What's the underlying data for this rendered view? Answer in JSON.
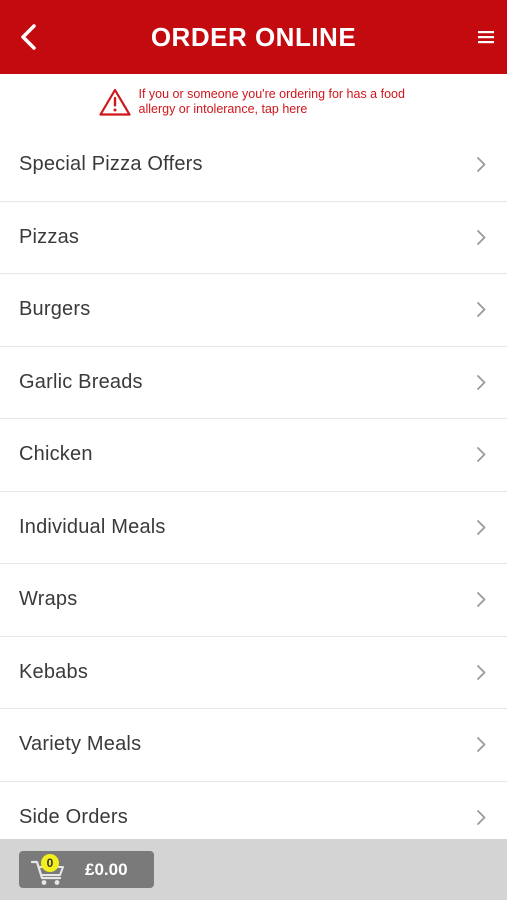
{
  "header": {
    "title": "ORDER ONLINE",
    "back_icon": "chevron-left-icon",
    "menu_icon": "hamburger-menu-icon",
    "background_color": "#c30a0f"
  },
  "allergy_notice": {
    "icon": "warning-triangle-icon",
    "text": "If you or someone you're ordering for has a food allergy or intolerance, tap here",
    "color": "#d0161b"
  },
  "categories": [
    {
      "label": "Special Pizza Offers"
    },
    {
      "label": "Pizzas"
    },
    {
      "label": "Burgers"
    },
    {
      "label": "Garlic Breads"
    },
    {
      "label": "Chicken"
    },
    {
      "label": "Individual Meals"
    },
    {
      "label": "Wraps"
    },
    {
      "label": "Kebabs"
    },
    {
      "label": "Variety Meals"
    },
    {
      "label": "Side Orders"
    }
  ],
  "cart": {
    "icon": "shopping-cart-icon",
    "count": "0",
    "total": "£0.00"
  }
}
